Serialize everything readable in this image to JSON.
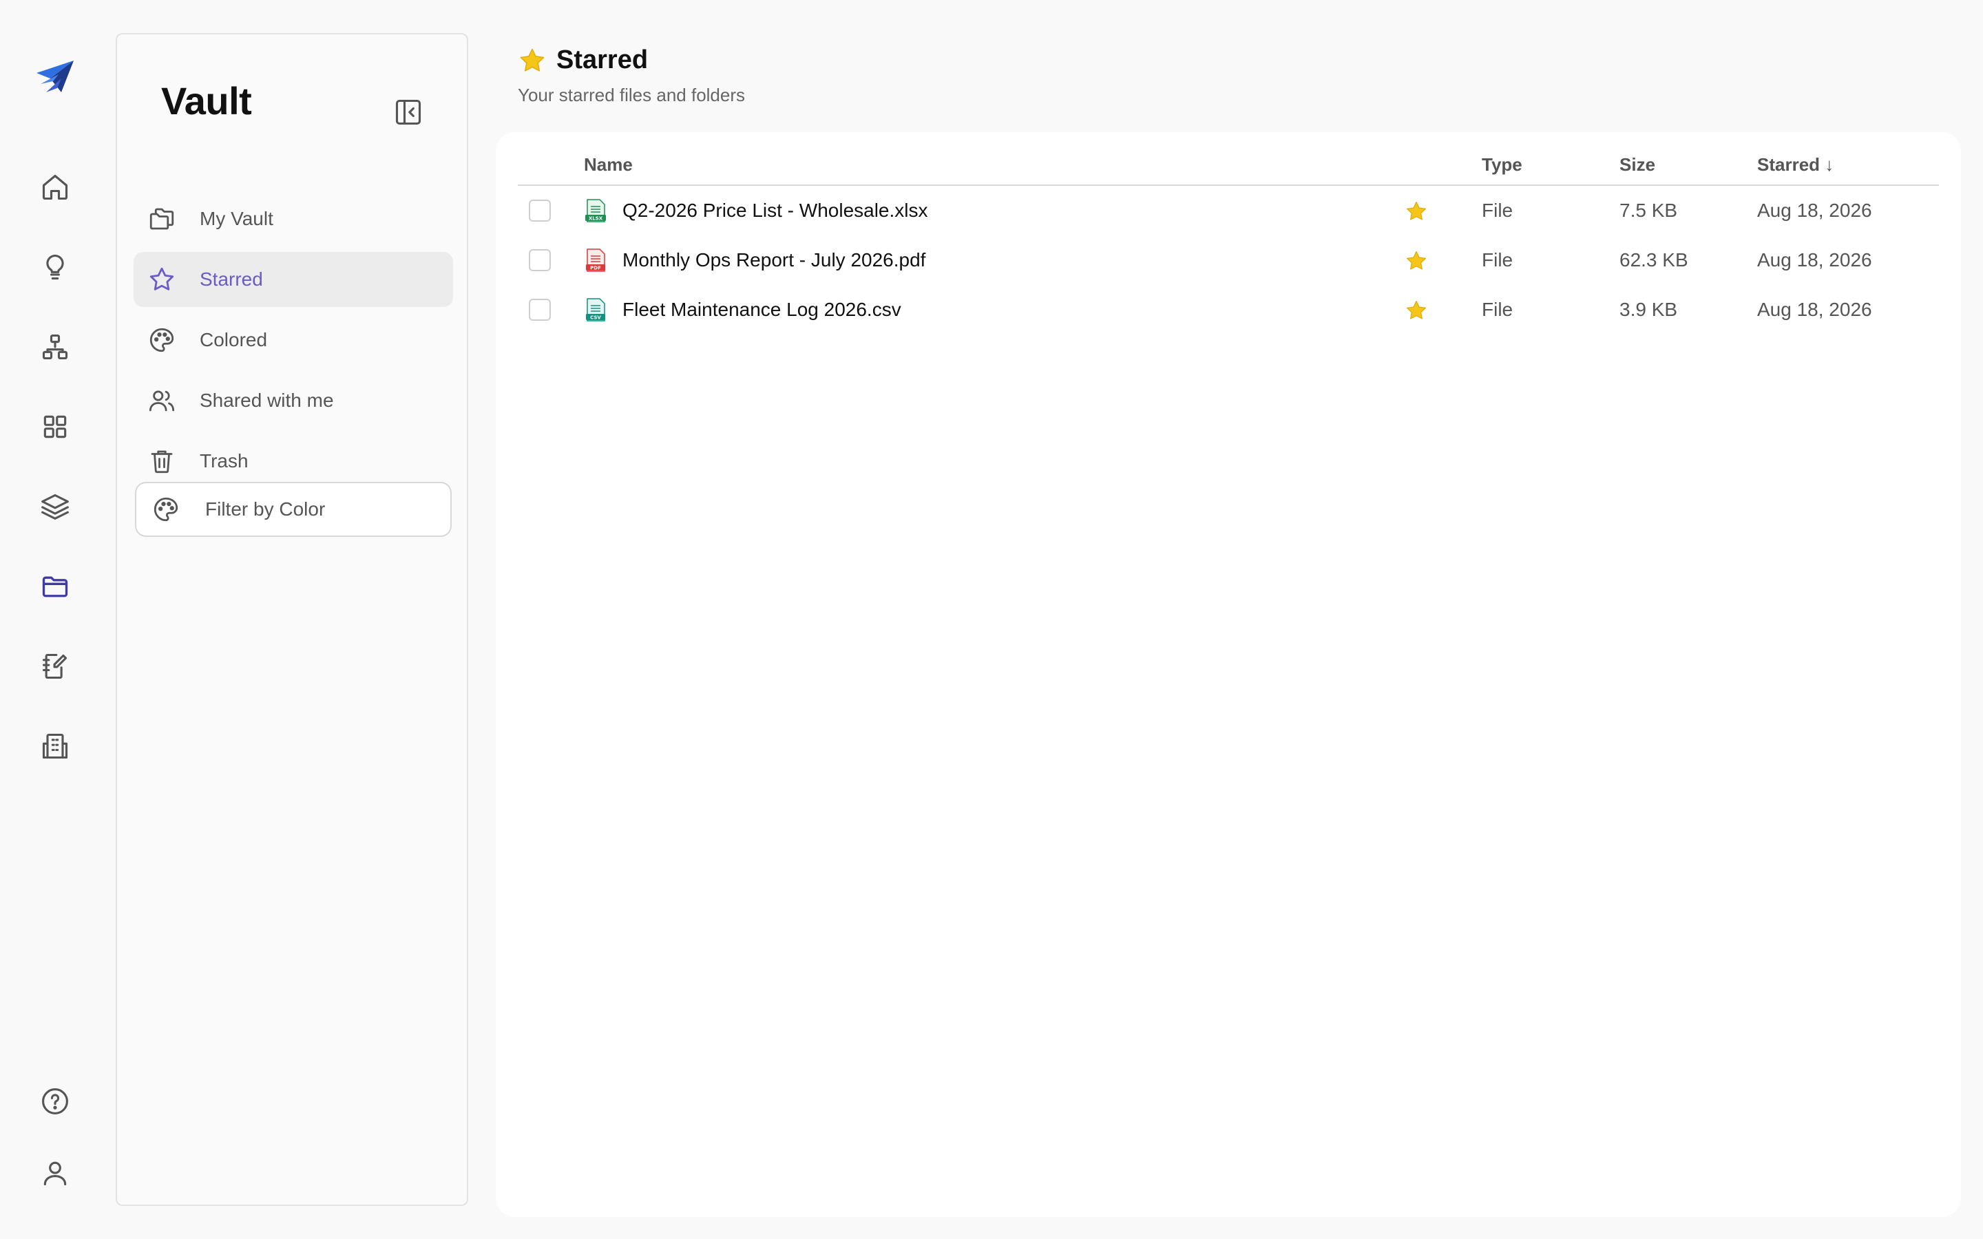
{
  "sidebar": {
    "title": "Vault",
    "items": [
      {
        "label": "My Vault"
      },
      {
        "label": "Starred"
      },
      {
        "label": "Colored"
      },
      {
        "label": "Shared with me"
      },
      {
        "label": "Trash"
      }
    ],
    "filter_label": "Filter by Color"
  },
  "header": {
    "title": "Starred",
    "subtitle": "Your starred files and folders"
  },
  "table": {
    "columns": {
      "name": "Name",
      "type": "Type",
      "size": "Size",
      "starred": "Starred ↓"
    },
    "rows": [
      {
        "name": "Q2-2026 Price List - Wholesale.xlsx",
        "icon": "xlsx-file-icon",
        "type": "File",
        "size": "7.5 KB",
        "starred": "Aug 18, 2026"
      },
      {
        "name": "Monthly Ops Report - July 2026.pdf",
        "icon": "pdf-file-icon",
        "type": "File",
        "size": "62.3 KB",
        "starred": "Aug 18, 2026"
      },
      {
        "name": "Fleet Maintenance Log 2026.csv",
        "icon": "csv-file-icon",
        "type": "File",
        "size": "3.9 KB",
        "starred": "Aug 18, 2026"
      }
    ]
  },
  "colors": {
    "accent": "#6b5bc7",
    "star": "#f5c518",
    "brand_blue": "#2563eb"
  }
}
